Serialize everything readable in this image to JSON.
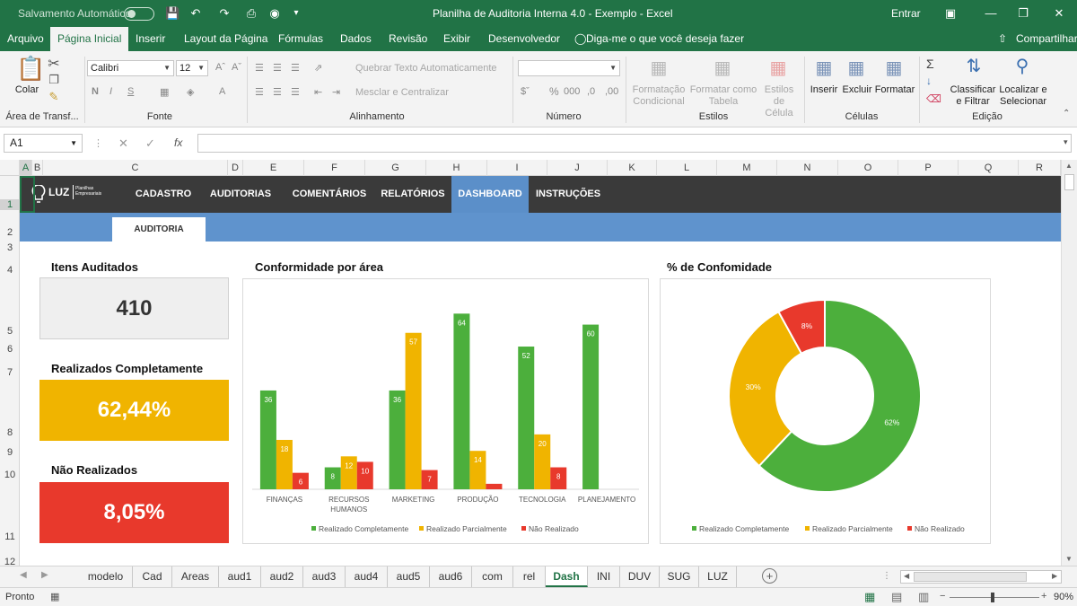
{
  "titlebar": {
    "autosave_label": "Salvamento Automático",
    "title": "Planilha de Auditoria Interna 4.0 - Exemplo  -  Excel",
    "signin": "Entrar"
  },
  "menu": {
    "tabs": [
      "Arquivo",
      "Página Inicial",
      "Inserir",
      "Layout da Página",
      "Fórmulas",
      "Dados",
      "Revisão",
      "Exibir",
      "Desenvolvedor"
    ],
    "tell_me": "Diga-me o que você deseja fazer",
    "share": "Compartilhar"
  },
  "ribbon": {
    "paste": "Colar",
    "font_name": "Calibri",
    "font_size": "12",
    "wrap_text": "Quebrar Texto Automaticamente",
    "merge_center": "Mesclar e Centralizar",
    "cond_format_1": "Formatação",
    "cond_format_2": "Condicional",
    "format_table_1": "Formatar como",
    "format_table_2": "Tabela",
    "cell_styles_1": "Estilos de",
    "cell_styles_2": "Célula",
    "insert": "Inserir",
    "delete": "Excluir",
    "format": "Formatar",
    "sort_filter_1": "Classificar",
    "sort_filter_2": "e Filtrar",
    "find_select_1": "Localizar e",
    "find_select_2": "Selecionar",
    "groups": {
      "clipboard": "Área de Transf...",
      "font": "Fonte",
      "alignment": "Alinhamento",
      "number": "Número",
      "styles": "Estilos",
      "cells": "Células",
      "editing": "Edição"
    }
  },
  "formula_bar": {
    "name_box": "A1",
    "formula": ""
  },
  "columns": [
    "A",
    "B",
    "C",
    "D",
    "E",
    "F",
    "G",
    "H",
    "I",
    "J",
    "K",
    "L",
    "M",
    "N",
    "O",
    "P",
    "Q",
    "R"
  ],
  "rows": [
    "1",
    "2",
    "3",
    "4",
    "5",
    "6",
    "7",
    "8",
    "9",
    "10",
    "11",
    "12"
  ],
  "dashboard": {
    "logo_text": "LUZ",
    "logo_sub_1": "Planilhas",
    "logo_sub_2": "Empresariais",
    "nav": [
      "CADASTRO",
      "AUDITORIAS",
      "COMENTÁRIOS",
      "RELATÓRIOS",
      "DASHBOARD",
      "INSTRUÇÕES"
    ],
    "subtab": "AUDITORIA",
    "kpis": {
      "items_label": "Itens Auditados",
      "items_value": "410",
      "done_label": "Realizados Completamente",
      "done_value": "62,44%",
      "not_label": "Não Realizados",
      "not_value": "8,05%"
    },
    "colors": {
      "green": "#4caf3c",
      "yellow": "#f0b400",
      "red": "#e8392c",
      "nav_bg": "#3a3a3a",
      "nav_active": "#5b8fc9"
    }
  },
  "chart_data": [
    {
      "type": "bar",
      "title": "Conformidade por área",
      "categories": [
        "FINANÇAS",
        "RECURSOS HUMANOS",
        "MARKETING",
        "PRODUÇÃO",
        "TECNOLOGIA",
        "PLANEJAMENTO"
      ],
      "series": [
        {
          "name": "Realizado Completamente",
          "color": "#4caf3c",
          "values": [
            36,
            8,
            36,
            64,
            52,
            60
          ]
        },
        {
          "name": "Realizado Parcialmente",
          "color": "#f0b400",
          "values": [
            18,
            12,
            57,
            14,
            20,
            0
          ]
        },
        {
          "name": "Não Realizado",
          "color": "#e8392c",
          "values": [
            6,
            10,
            7,
            2,
            8,
            0
          ]
        }
      ],
      "data_labels": [
        [
          "36",
          "8",
          "36",
          "64",
          "52",
          "60"
        ],
        [
          "18",
          "12",
          "57",
          "14",
          "20",
          ""
        ],
        [
          "6",
          "10",
          "7",
          "",
          "8",
          ""
        ]
      ],
      "ylim": [
        0,
        70
      ],
      "legend": "bottom"
    },
    {
      "type": "pie",
      "title": "% de Confomidade",
      "donut": true,
      "labels": [
        "Realizado Completamente",
        "Realizado Parcialmente",
        "Não Realizado"
      ],
      "values": [
        62,
        30,
        8
      ],
      "value_labels": [
        "62%",
        "30%",
        "8%"
      ],
      "colors": [
        "#4caf3c",
        "#f0b400",
        "#e8392c"
      ],
      "legend": "bottom"
    }
  ],
  "sheet_tabs": [
    "modelo",
    "Cad",
    "Areas",
    "aud1",
    "aud2",
    "aud3",
    "aud4",
    "aud5",
    "aud6",
    "com",
    "rel",
    "Dash",
    "INI",
    "DUV",
    "SUG",
    "LUZ"
  ],
  "active_sheet": "Dash",
  "status": {
    "ready": "Pronto",
    "zoom": "90%"
  }
}
